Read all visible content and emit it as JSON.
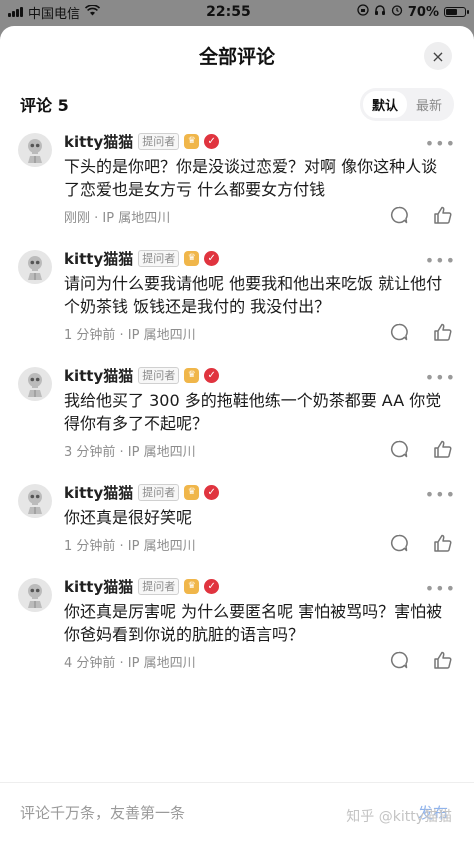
{
  "status_bar": {
    "carrier": "中国电信",
    "time": "22:55",
    "battery_text": "70%",
    "battery_level": 0.7
  },
  "header": {
    "title": "全部评论",
    "close_icon": "×"
  },
  "count_row": {
    "label": "评论 5",
    "sort_options": [
      "默认",
      "最新"
    ],
    "active_sort": "默认"
  },
  "comments": [
    {
      "username": "kitty猫猫",
      "badge": "提问者",
      "content": "下头的是你吧？你是没谈过恋爱？对啊 像你这种人谈了恋爱也是女方亏 什么都要女方付钱",
      "time_ip": "刚刚 · IP 属地四川"
    },
    {
      "username": "kitty猫猫",
      "badge": "提问者",
      "content": "请问为什么要我请他呢 他要我和他出来吃饭 就让他付个奶茶钱 饭钱还是我付的 我没付出？",
      "time_ip": "1 分钟前 · IP 属地四川"
    },
    {
      "username": "kitty猫猫",
      "badge": "提问者",
      "content": "我给他买了 300 多的拖鞋他练一个奶茶都要 AA 你觉得你有多了不起呢？",
      "time_ip": "3 分钟前 · IP 属地四川"
    },
    {
      "username": "kitty猫猫",
      "badge": "提问者",
      "content": "你还真是很好笑呢",
      "time_ip": "1 分钟前 · IP 属地四川"
    },
    {
      "username": "kitty猫猫",
      "badge": "提问者",
      "content": "你还真是厉害呢 为什么要匿名呢 害怕被骂吗？害怕被你爸妈看到你说的肮脏的语言吗？",
      "time_ip": "4 分钟前 · IP 属地四川"
    }
  ],
  "bottom_bar": {
    "placeholder": "评论千万条，友善第一条",
    "send_label": "发布",
    "watermark": "知乎 @kitty猫猫"
  },
  "colors": {
    "crown": "#f0b64a",
    "verify": "#e0343f",
    "send": "#8fb3ec"
  }
}
